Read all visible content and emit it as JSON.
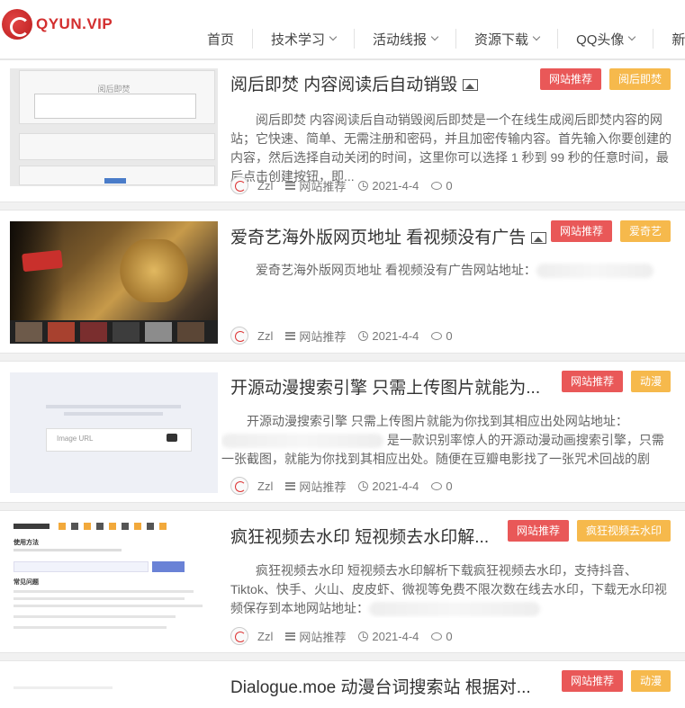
{
  "site": {
    "logo_text": "QYUN.VIP"
  },
  "nav": [
    {
      "label": "首页",
      "has_dropdown": false
    },
    {
      "label": "技术学习",
      "has_dropdown": true
    },
    {
      "label": "活动线报",
      "has_dropdown": true
    },
    {
      "label": "资源下载",
      "has_dropdown": true
    },
    {
      "label": "QQ头像",
      "has_dropdown": true
    },
    {
      "label": "新闻",
      "has_dropdown": false
    }
  ],
  "posts": [
    {
      "title": "阅后即焚 内容阅读后自动销毁",
      "badges": [
        "网站推荐",
        "阅后即焚"
      ],
      "excerpt": "阅后即焚 内容阅读后自动销毁阅后即焚是一个在线生成阅后即焚内容的网站；它快速、简单、无需注册和密码，并且加密传输内容。首先输入你要创建的内容，然后选择自动关闭的时间，这里你可以选择 1 秒到 99 秒的任意时间，最后点击创建按钮，即...",
      "excerpt_suffix": "",
      "author": "Zzl",
      "category": "网站推荐",
      "date": "2021-4-4",
      "comments": "0",
      "thumb_text": [
        "阅后即焚"
      ]
    },
    {
      "title": "爱奇艺海外版网页地址 看视频没有广告",
      "badges": [
        "网站推荐",
        "爱奇艺"
      ],
      "excerpt": "爱奇艺海外版网页地址 看视频没有广告网站地址：",
      "excerpt_suffix": "",
      "author": "Zzl",
      "category": "网站推荐",
      "date": "2021-4-4",
      "comments": "0",
      "thumb_text": []
    },
    {
      "title": "开源动漫搜索引擎 只需上传图片就能为...",
      "badges": [
        "网站推荐",
        "动漫"
      ],
      "excerpt": "开源动漫搜索引擎 只需上传图片就能为你找到其相应出处网站地址：",
      "excerpt_suffix": "是一款识别率惊人的开源动漫动画搜索引擎，只需一张截图，就能为你找到其相应出处。随便在豆瓣电影找了一张咒术回战的剧照...",
      "author": "Zzl",
      "category": "网站推荐",
      "date": "2021-4-4",
      "comments": "0",
      "thumb_text": [
        "Image URL"
      ]
    },
    {
      "title": "疯狂视频去水印 短视频去水印解...",
      "badges": [
        "网站推荐",
        "疯狂视频去水印"
      ],
      "excerpt": "疯狂视频去水印 短视频去水印解析下载疯狂视频去水印，支持抖音、Tiktok、快手、火山、皮皮虾、微视等免费不限次数在线去水印，下载无水印视频保存到本地网站地址：",
      "excerpt_suffix": "",
      "author": "Zzl",
      "category": "网站推荐",
      "date": "2021-4-4",
      "comments": "0",
      "thumb_text": [
        "使用方法",
        "常见问题"
      ]
    },
    {
      "title": "Dialogue.moe 动漫台词搜索站 根据对...",
      "badges": [
        "网站推荐",
        "动漫"
      ],
      "excerpt": "",
      "excerpt_suffix": "",
      "author": "",
      "category": "",
      "date": "",
      "comments": "",
      "thumb_text": []
    }
  ],
  "colors": {
    "brand": "#d32f2f",
    "badge_red": "#e95858",
    "badge_orange": "#f6b94c"
  }
}
